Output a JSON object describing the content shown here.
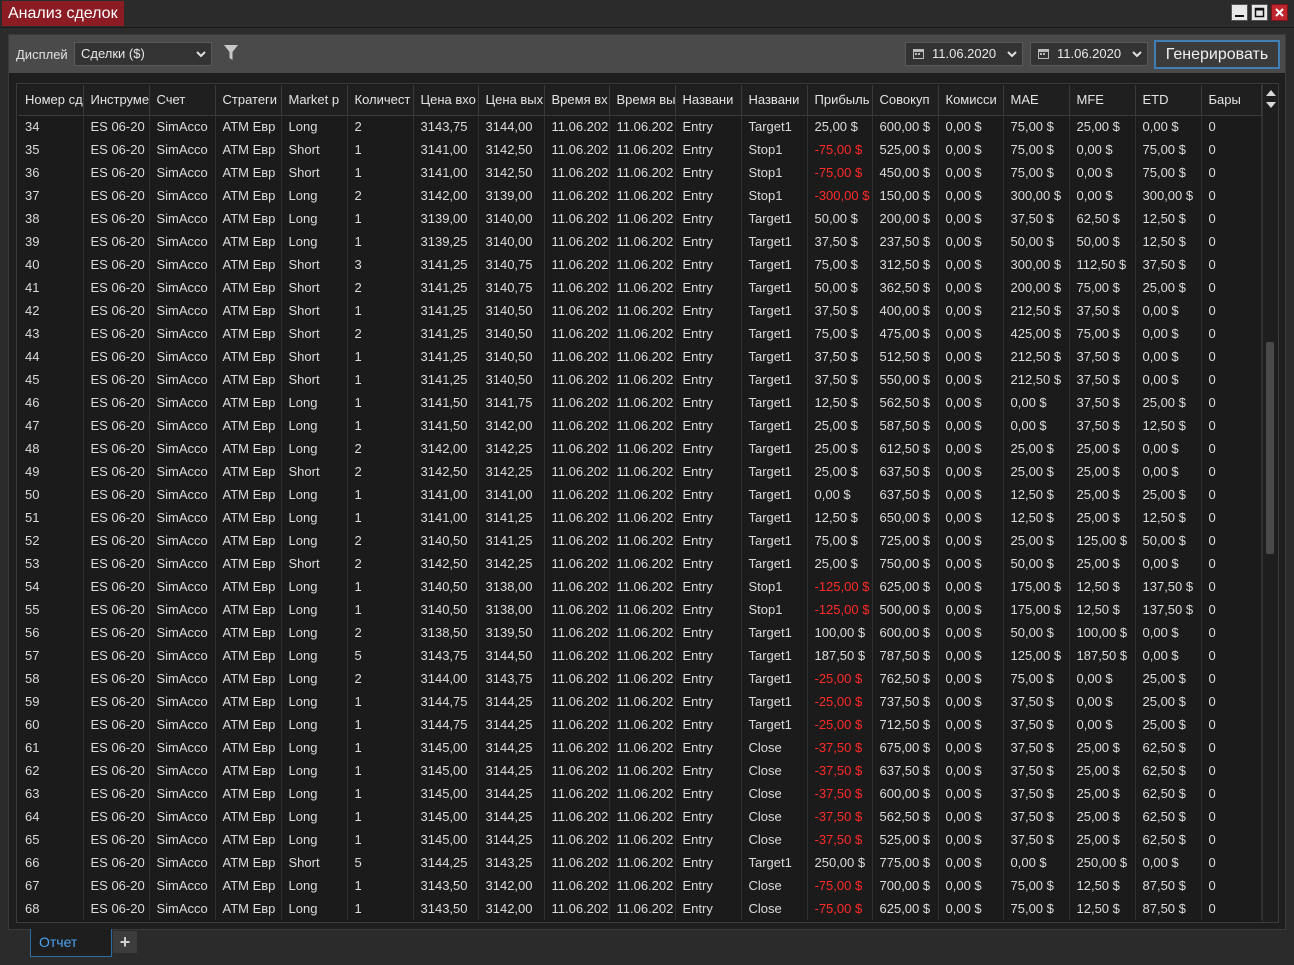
{
  "window": {
    "title": "Анализ сделок"
  },
  "toolbar": {
    "display_label": "Дисплей",
    "display_value": "Сделки ($)",
    "date_from": "11.06.2020",
    "date_to": "11.06.2020",
    "generate_label": "Генерировать"
  },
  "grid": {
    "columns": [
      "Номер сд",
      "Инструме",
      "Счет",
      "Стратеги",
      "Market p",
      "Количест",
      "Цена вхо",
      "Цена вых",
      "Время вх",
      "Время вы",
      "Названи",
      "Названи",
      "Прибыль",
      "Совокуп",
      "Комисси",
      "MAE",
      "MFE",
      "ETD",
      "Бары"
    ],
    "rows": [
      [
        "34",
        "ES 06-20",
        "SimAcco",
        "ATM Евр",
        "Long",
        "2",
        "3143,75",
        "3144,00",
        "11.06.202",
        "11.06.202",
        "Entry",
        "Target1",
        "25,00 $",
        "600,00 $",
        "0,00 $",
        "75,00 $",
        "25,00 $",
        "0,00 $",
        "0"
      ],
      [
        "35",
        "ES 06-20",
        "SimAcco",
        "ATM Евр",
        "Short",
        "1",
        "3141,00",
        "3142,50",
        "11.06.202",
        "11.06.202",
        "Entry",
        "Stop1",
        "-75,00 $",
        "525,00 $",
        "0,00 $",
        "75,00 $",
        "0,00 $",
        "75,00 $",
        "0"
      ],
      [
        "36",
        "ES 06-20",
        "SimAcco",
        "ATM Евр",
        "Short",
        "1",
        "3141,00",
        "3142,50",
        "11.06.202",
        "11.06.202",
        "Entry",
        "Stop1",
        "-75,00 $",
        "450,00 $",
        "0,00 $",
        "75,00 $",
        "0,00 $",
        "75,00 $",
        "0"
      ],
      [
        "37",
        "ES 06-20",
        "SimAcco",
        "ATM Евр",
        "Long",
        "2",
        "3142,00",
        "3139,00",
        "11.06.202",
        "11.06.202",
        "Entry",
        "Stop1",
        "-300,00 $",
        "150,00 $",
        "0,00 $",
        "300,00 $",
        "0,00 $",
        "300,00 $",
        "0"
      ],
      [
        "38",
        "ES 06-20",
        "SimAcco",
        "ATM Евр",
        "Long",
        "1",
        "3139,00",
        "3140,00",
        "11.06.202",
        "11.06.202",
        "Entry",
        "Target1",
        "50,00 $",
        "200,00 $",
        "0,00 $",
        "37,50 $",
        "62,50 $",
        "12,50 $",
        "0"
      ],
      [
        "39",
        "ES 06-20",
        "SimAcco",
        "ATM Евр",
        "Long",
        "1",
        "3139,25",
        "3140,00",
        "11.06.202",
        "11.06.202",
        "Entry",
        "Target1",
        "37,50 $",
        "237,50 $",
        "0,00 $",
        "50,00 $",
        "50,00 $",
        "12,50 $",
        "0"
      ],
      [
        "40",
        "ES 06-20",
        "SimAcco",
        "ATM Евр",
        "Short",
        "3",
        "3141,25",
        "3140,75",
        "11.06.202",
        "11.06.202",
        "Entry",
        "Target1",
        "75,00 $",
        "312,50 $",
        "0,00 $",
        "300,00 $",
        "112,50 $",
        "37,50 $",
        "0"
      ],
      [
        "41",
        "ES 06-20",
        "SimAcco",
        "ATM Евр",
        "Short",
        "2",
        "3141,25",
        "3140,75",
        "11.06.202",
        "11.06.202",
        "Entry",
        "Target1",
        "50,00 $",
        "362,50 $",
        "0,00 $",
        "200,00 $",
        "75,00 $",
        "25,00 $",
        "0"
      ],
      [
        "42",
        "ES 06-20",
        "SimAcco",
        "ATM Евр",
        "Short",
        "1",
        "3141,25",
        "3140,50",
        "11.06.202",
        "11.06.202",
        "Entry",
        "Target1",
        "37,50 $",
        "400,00 $",
        "0,00 $",
        "212,50 $",
        "37,50 $",
        "0,00 $",
        "0"
      ],
      [
        "43",
        "ES 06-20",
        "SimAcco",
        "ATM Евр",
        "Short",
        "2",
        "3141,25",
        "3140,50",
        "11.06.202",
        "11.06.202",
        "Entry",
        "Target1",
        "75,00 $",
        "475,00 $",
        "0,00 $",
        "425,00 $",
        "75,00 $",
        "0,00 $",
        "0"
      ],
      [
        "44",
        "ES 06-20",
        "SimAcco",
        "ATM Евр",
        "Short",
        "1",
        "3141,25",
        "3140,50",
        "11.06.202",
        "11.06.202",
        "Entry",
        "Target1",
        "37,50 $",
        "512,50 $",
        "0,00 $",
        "212,50 $",
        "37,50 $",
        "0,00 $",
        "0"
      ],
      [
        "45",
        "ES 06-20",
        "SimAcco",
        "ATM Евр",
        "Short",
        "1",
        "3141,25",
        "3140,50",
        "11.06.202",
        "11.06.202",
        "Entry",
        "Target1",
        "37,50 $",
        "550,00 $",
        "0,00 $",
        "212,50 $",
        "37,50 $",
        "0,00 $",
        "0"
      ],
      [
        "46",
        "ES 06-20",
        "SimAcco",
        "ATM Евр",
        "Long",
        "1",
        "3141,50",
        "3141,75",
        "11.06.202",
        "11.06.202",
        "Entry",
        "Target1",
        "12,50 $",
        "562,50 $",
        "0,00 $",
        "0,00 $",
        "37,50 $",
        "25,00 $",
        "0"
      ],
      [
        "47",
        "ES 06-20",
        "SimAcco",
        "ATM Евр",
        "Long",
        "1",
        "3141,50",
        "3142,00",
        "11.06.202",
        "11.06.202",
        "Entry",
        "Target1",
        "25,00 $",
        "587,50 $",
        "0,00 $",
        "0,00 $",
        "37,50 $",
        "12,50 $",
        "0"
      ],
      [
        "48",
        "ES 06-20",
        "SimAcco",
        "ATM Евр",
        "Long",
        "2",
        "3142,00",
        "3142,25",
        "11.06.202",
        "11.06.202",
        "Entry",
        "Target1",
        "25,00 $",
        "612,50 $",
        "0,00 $",
        "25,00 $",
        "25,00 $",
        "0,00 $",
        "0"
      ],
      [
        "49",
        "ES 06-20",
        "SimAcco",
        "ATM Евр",
        "Short",
        "2",
        "3142,50",
        "3142,25",
        "11.06.202",
        "11.06.202",
        "Entry",
        "Target1",
        "25,00 $",
        "637,50 $",
        "0,00 $",
        "25,00 $",
        "25,00 $",
        "0,00 $",
        "0"
      ],
      [
        "50",
        "ES 06-20",
        "SimAcco",
        "ATM Евр",
        "Long",
        "1",
        "3141,00",
        "3141,00",
        "11.06.202",
        "11.06.202",
        "Entry",
        "Target1",
        "0,00 $",
        "637,50 $",
        "0,00 $",
        "12,50 $",
        "25,00 $",
        "25,00 $",
        "0"
      ],
      [
        "51",
        "ES 06-20",
        "SimAcco",
        "ATM Евр",
        "Long",
        "1",
        "3141,00",
        "3141,25",
        "11.06.202",
        "11.06.202",
        "Entry",
        "Target1",
        "12,50 $",
        "650,00 $",
        "0,00 $",
        "12,50 $",
        "25,00 $",
        "12,50 $",
        "0"
      ],
      [
        "52",
        "ES 06-20",
        "SimAcco",
        "ATM Евр",
        "Long",
        "2",
        "3140,50",
        "3141,25",
        "11.06.202",
        "11.06.202",
        "Entry",
        "Target1",
        "75,00 $",
        "725,00 $",
        "0,00 $",
        "25,00 $",
        "125,00 $",
        "50,00 $",
        "0"
      ],
      [
        "53",
        "ES 06-20",
        "SimAcco",
        "ATM Евр",
        "Short",
        "2",
        "3142,50",
        "3142,25",
        "11.06.202",
        "11.06.202",
        "Entry",
        "Target1",
        "25,00 $",
        "750,00 $",
        "0,00 $",
        "50,00 $",
        "25,00 $",
        "0,00 $",
        "0"
      ],
      [
        "54",
        "ES 06-20",
        "SimAcco",
        "ATM Евр",
        "Long",
        "1",
        "3140,50",
        "3138,00",
        "11.06.202",
        "11.06.202",
        "Entry",
        "Stop1",
        "-125,00 $",
        "625,00 $",
        "0,00 $",
        "175,00 $",
        "12,50 $",
        "137,50 $",
        "0"
      ],
      [
        "55",
        "ES 06-20",
        "SimAcco",
        "ATM Евр",
        "Long",
        "1",
        "3140,50",
        "3138,00",
        "11.06.202",
        "11.06.202",
        "Entry",
        "Stop1",
        "-125,00 $",
        "500,00 $",
        "0,00 $",
        "175,00 $",
        "12,50 $",
        "137,50 $",
        "0"
      ],
      [
        "56",
        "ES 06-20",
        "SimAcco",
        "ATM Евр",
        "Long",
        "2",
        "3138,50",
        "3139,50",
        "11.06.202",
        "11.06.202",
        "Entry",
        "Target1",
        "100,00 $",
        "600,00 $",
        "0,00 $",
        "50,00 $",
        "100,00 $",
        "0,00 $",
        "0"
      ],
      [
        "57",
        "ES 06-20",
        "SimAcco",
        "ATM Евр",
        "Long",
        "5",
        "3143,75",
        "3144,50",
        "11.06.202",
        "11.06.202",
        "Entry",
        "Target1",
        "187,50 $",
        "787,50 $",
        "0,00 $",
        "125,00 $",
        "187,50 $",
        "0,00 $",
        "0"
      ],
      [
        "58",
        "ES 06-20",
        "SimAcco",
        "ATM Евр",
        "Long",
        "2",
        "3144,00",
        "3143,75",
        "11.06.202",
        "11.06.202",
        "Entry",
        "Target1",
        "-25,00 $",
        "762,50 $",
        "0,00 $",
        "75,00 $",
        "0,00 $",
        "25,00 $",
        "0"
      ],
      [
        "59",
        "ES 06-20",
        "SimAcco",
        "ATM Евр",
        "Long",
        "1",
        "3144,75",
        "3144,25",
        "11.06.202",
        "11.06.202",
        "Entry",
        "Target1",
        "-25,00 $",
        "737,50 $",
        "0,00 $",
        "37,50 $",
        "0,00 $",
        "25,00 $",
        "0"
      ],
      [
        "60",
        "ES 06-20",
        "SimAcco",
        "ATM Евр",
        "Long",
        "1",
        "3144,75",
        "3144,25",
        "11.06.202",
        "11.06.202",
        "Entry",
        "Target1",
        "-25,00 $",
        "712,50 $",
        "0,00 $",
        "37,50 $",
        "0,00 $",
        "25,00 $",
        "0"
      ],
      [
        "61",
        "ES 06-20",
        "SimAcco",
        "ATM Евр",
        "Long",
        "1",
        "3145,00",
        "3144,25",
        "11.06.202",
        "11.06.202",
        "Entry",
        "Close",
        "-37,50 $",
        "675,00 $",
        "0,00 $",
        "37,50 $",
        "25,00 $",
        "62,50 $",
        "0"
      ],
      [
        "62",
        "ES 06-20",
        "SimAcco",
        "ATM Евр",
        "Long",
        "1",
        "3145,00",
        "3144,25",
        "11.06.202",
        "11.06.202",
        "Entry",
        "Close",
        "-37,50 $",
        "637,50 $",
        "0,00 $",
        "37,50 $",
        "25,00 $",
        "62,50 $",
        "0"
      ],
      [
        "63",
        "ES 06-20",
        "SimAcco",
        "ATM Евр",
        "Long",
        "1",
        "3145,00",
        "3144,25",
        "11.06.202",
        "11.06.202",
        "Entry",
        "Close",
        "-37,50 $",
        "600,00 $",
        "0,00 $",
        "37,50 $",
        "25,00 $",
        "62,50 $",
        "0"
      ],
      [
        "64",
        "ES 06-20",
        "SimAcco",
        "ATM Евр",
        "Long",
        "1",
        "3145,00",
        "3144,25",
        "11.06.202",
        "11.06.202",
        "Entry",
        "Close",
        "-37,50 $",
        "562,50 $",
        "0,00 $",
        "37,50 $",
        "25,00 $",
        "62,50 $",
        "0"
      ],
      [
        "65",
        "ES 06-20",
        "SimAcco",
        "ATM Евр",
        "Long",
        "1",
        "3145,00",
        "3144,25",
        "11.06.202",
        "11.06.202",
        "Entry",
        "Close",
        "-37,50 $",
        "525,00 $",
        "0,00 $",
        "37,50 $",
        "25,00 $",
        "62,50 $",
        "0"
      ],
      [
        "66",
        "ES 06-20",
        "SimAcco",
        "ATM Евр",
        "Short",
        "5",
        "3144,25",
        "3143,25",
        "11.06.202",
        "11.06.202",
        "Entry",
        "Target1",
        "250,00 $",
        "775,00 $",
        "0,00 $",
        "0,00 $",
        "250,00 $",
        "0,00 $",
        "0"
      ],
      [
        "67",
        "ES 06-20",
        "SimAcco",
        "ATM Евр",
        "Long",
        "1",
        "3143,50",
        "3142,00",
        "11.06.202",
        "11.06.202",
        "Entry",
        "Close",
        "-75,00 $",
        "700,00 $",
        "0,00 $",
        "75,00 $",
        "12,50 $",
        "87,50 $",
        "0"
      ],
      [
        "68",
        "ES 06-20",
        "SimAcco",
        "ATM Евр",
        "Long",
        "1",
        "3143,50",
        "3142,00",
        "11.06.202",
        "11.06.202",
        "Entry",
        "Close",
        "-75,00 $",
        "625,00 $",
        "0,00 $",
        "75,00 $",
        "12,50 $",
        "87,50 $",
        "0"
      ]
    ]
  },
  "tabs": {
    "active_label": "Отчет",
    "add_label": "+"
  },
  "colors": {
    "title_tab": "#8b1c24",
    "accent": "#3f7fb5",
    "negative": "#ff2a2a",
    "tab_text": "#4aa3f0"
  },
  "icons": [
    "minimize-icon",
    "maximize-icon",
    "close-icon",
    "filter-icon",
    "calendar-icon",
    "chevron-down-icon",
    "scroll-up-icon",
    "scroll-down-icon"
  ]
}
